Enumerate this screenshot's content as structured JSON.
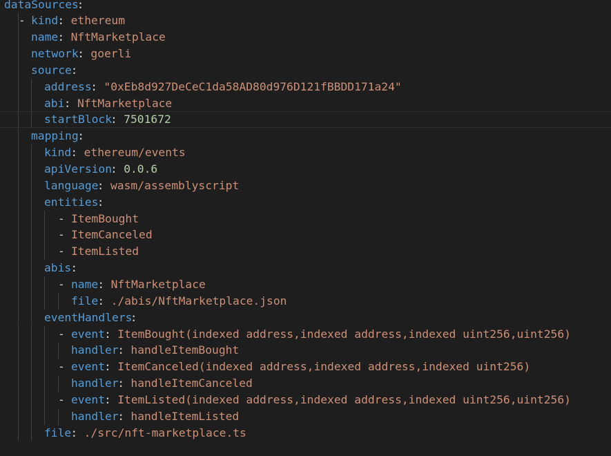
{
  "editor": {
    "lines": [
      {
        "dash": "",
        "key": "dataSources",
        "value": "",
        "vtype": "str"
      },
      {
        "dash": "-",
        "key": "kind",
        "value": "ethereum",
        "vtype": "str"
      },
      {
        "dash": "",
        "key": "name",
        "value": "NftMarketplace",
        "vtype": "str"
      },
      {
        "dash": "",
        "key": "network",
        "value": "goerli",
        "vtype": "str"
      },
      {
        "dash": "",
        "key": "source",
        "value": "",
        "vtype": "str"
      },
      {
        "dash": "",
        "key": "address",
        "value": "\"0xEb8d927DeCeC1da58AD80d976D121fBBDD171a24\"",
        "vtype": "str"
      },
      {
        "dash": "",
        "key": "abi",
        "value": "NftMarketplace",
        "vtype": "str"
      },
      {
        "dash": "",
        "key": "startBlock",
        "value": "7501672",
        "vtype": "num"
      },
      {
        "dash": "",
        "key": "mapping",
        "value": "",
        "vtype": "str"
      },
      {
        "dash": "",
        "key": "kind",
        "value": "ethereum/events",
        "vtype": "str"
      },
      {
        "dash": "",
        "key": "apiVersion",
        "value": "0.0.6",
        "vtype": "num"
      },
      {
        "dash": "",
        "key": "language",
        "value": "wasm/assemblyscript",
        "vtype": "str"
      },
      {
        "dash": "",
        "key": "entities",
        "value": "",
        "vtype": "str"
      },
      {
        "dash": "-",
        "key": "",
        "value": "ItemBought",
        "vtype": "str"
      },
      {
        "dash": "-",
        "key": "",
        "value": "ItemCanceled",
        "vtype": "str"
      },
      {
        "dash": "-",
        "key": "",
        "value": "ItemListed",
        "vtype": "str"
      },
      {
        "dash": "",
        "key": "abis",
        "value": "",
        "vtype": "str"
      },
      {
        "dash": "-",
        "key": "name",
        "value": "NftMarketplace",
        "vtype": "str"
      },
      {
        "dash": "",
        "key": "file",
        "value": "./abis/NftMarketplace.json",
        "vtype": "str"
      },
      {
        "dash": "",
        "key": "eventHandlers",
        "value": "",
        "vtype": "str"
      },
      {
        "dash": "-",
        "key": "event",
        "value": "ItemBought(indexed address,indexed address,indexed uint256,uint256)",
        "vtype": "str"
      },
      {
        "dash": "",
        "key": "handler",
        "value": "handleItemBought",
        "vtype": "str"
      },
      {
        "dash": "-",
        "key": "event",
        "value": "ItemCanceled(indexed address,indexed address,indexed uint256)",
        "vtype": "str"
      },
      {
        "dash": "",
        "key": "handler",
        "value": "handleItemCanceled",
        "vtype": "str"
      },
      {
        "dash": "-",
        "key": "event",
        "value": "ItemListed(indexed address,indexed address,indexed uint256,uint256)",
        "vtype": "str"
      },
      {
        "dash": "",
        "key": "handler",
        "value": "handleItemListed",
        "vtype": "str"
      },
      {
        "dash": "",
        "key": "file",
        "value": "./src/nft-marketplace.ts",
        "vtype": "str"
      }
    ]
  },
  "colors": {
    "background": "#1e1e1e",
    "key": "#569cd6",
    "string": "#ce9178",
    "number": "#b5cea8",
    "punctuation": "#d4d4d4",
    "indent_guide": "#404040"
  }
}
